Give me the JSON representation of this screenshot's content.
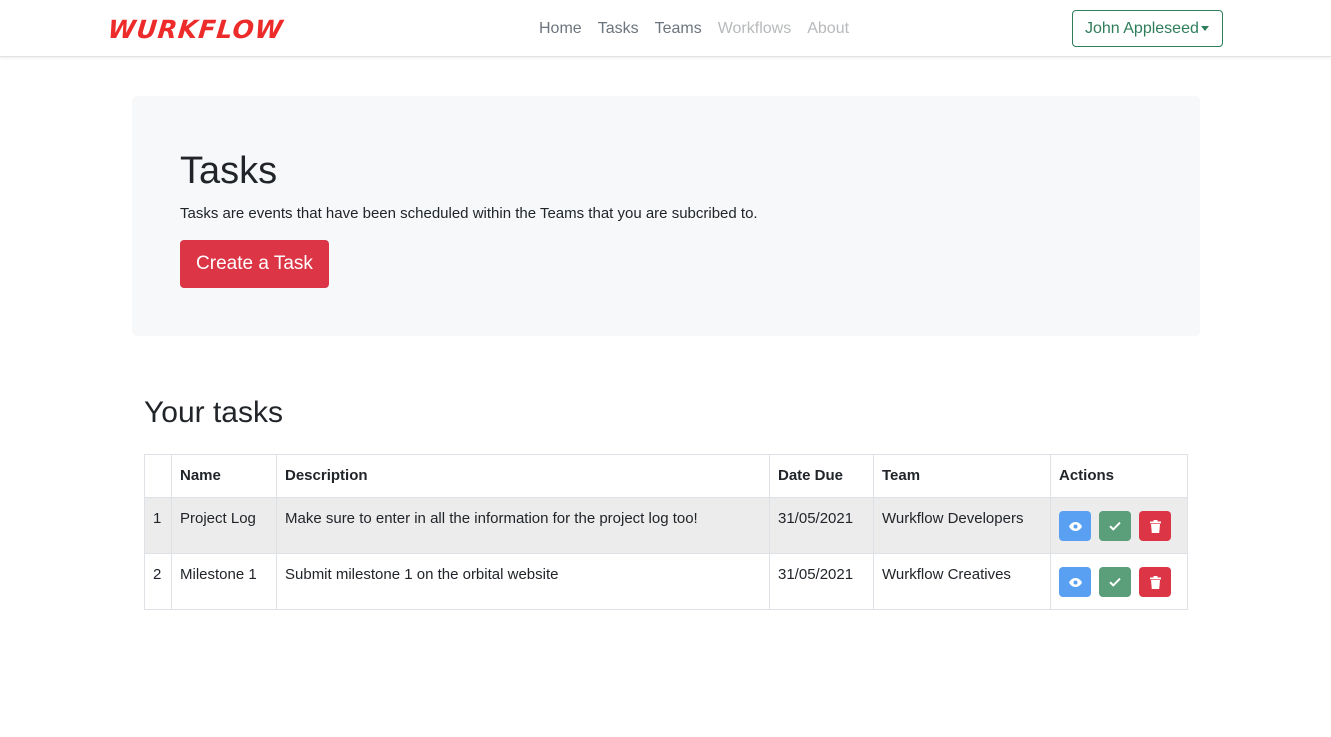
{
  "navbar": {
    "brand": "WURKFLOW",
    "links": [
      {
        "label": "Home"
      },
      {
        "label": "Tasks"
      },
      {
        "label": "Teams"
      },
      {
        "label": "Workflows"
      },
      {
        "label": "About"
      }
    ],
    "user": "John Appleseed"
  },
  "jumbotron": {
    "title": "Tasks",
    "description": "Tasks are events that have been scheduled within the Teams that you are subcribed to.",
    "button_label": "Create a Task"
  },
  "tasks_section": {
    "title": "Your tasks",
    "columns": [
      "",
      "Name",
      "Description",
      "Date Due",
      "Team",
      "Actions"
    ],
    "rows": [
      {
        "index": "1",
        "name": "Project Log",
        "description": "Make sure to enter in all the information for the project log too!",
        "date_due": "31/05/2021",
        "team": "Wurkflow Developers"
      },
      {
        "index": "2",
        "name": "Milestone 1",
        "description": "Submit milestone 1 on the orbital website",
        "date_due": "31/05/2021",
        "team": "Wurkflow Creatives"
      }
    ]
  },
  "colors": {
    "brand": "#ee2b2b",
    "primary_danger": "#dc3545",
    "view": "#5aa0f2",
    "complete": "#5a9e7a",
    "user_outline": "#2e7d5b"
  },
  "icons": {
    "view": "eye-icon",
    "complete": "check-icon",
    "delete": "trash-icon",
    "dropdown": "caret-down-icon"
  }
}
